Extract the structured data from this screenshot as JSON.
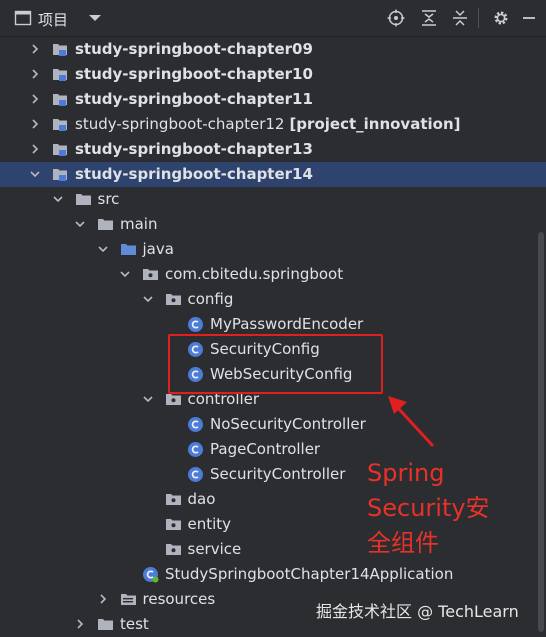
{
  "toolbar": {
    "title": "项目",
    "icons": [
      "project-view-icon",
      "dropdown-icon",
      "locate-icon",
      "expand-all-icon",
      "collapse-all-icon",
      "gear-icon",
      "minimize-icon"
    ]
  },
  "tree": [
    {
      "label": "study-springboot-chapter09",
      "bold": true,
      "expanded": false,
      "icon": "module-icon",
      "suffix": ""
    },
    {
      "label": "study-springboot-chapter10",
      "bold": true,
      "expanded": false,
      "icon": "module-icon",
      "suffix": ""
    },
    {
      "label": "study-springboot-chapter11",
      "bold": true,
      "expanded": false,
      "icon": "module-icon",
      "suffix": ""
    },
    {
      "label": "study-springboot-chapter12",
      "bold": false,
      "expanded": false,
      "icon": "module-icon",
      "suffix": "[project_innovation]"
    },
    {
      "label": "study-springboot-chapter13",
      "bold": true,
      "expanded": false,
      "icon": "module-icon",
      "suffix": ""
    },
    {
      "label": "study-springboot-chapter14",
      "bold": true,
      "expanded": true,
      "icon": "module-icon",
      "selected": true,
      "suffix": ""
    },
    {
      "label": "src",
      "icon": "folder-icon",
      "expanded": true
    },
    {
      "label": "main",
      "icon": "folder-icon",
      "expanded": true
    },
    {
      "label": "java",
      "icon": "source-folder-icon",
      "expanded": true
    },
    {
      "label": "com.cbitedu.springboot",
      "icon": "package-icon",
      "expanded": true
    },
    {
      "label": "config",
      "icon": "package-icon",
      "expanded": true
    },
    {
      "label": "MyPasswordEncoder",
      "icon": "class-icon"
    },
    {
      "label": "SecurityConfig",
      "icon": "class-icon"
    },
    {
      "label": "WebSecurityConfig",
      "icon": "class-icon"
    },
    {
      "label": "controller",
      "icon": "package-icon",
      "expanded": true
    },
    {
      "label": "NoSecurityController",
      "icon": "class-icon"
    },
    {
      "label": "PageController",
      "icon": "class-icon"
    },
    {
      "label": "SecurityController",
      "icon": "class-icon"
    },
    {
      "label": "dao",
      "icon": "package-icon"
    },
    {
      "label": "entity",
      "icon": "package-icon"
    },
    {
      "label": "service",
      "icon": "package-icon"
    },
    {
      "label": "StudySpringbootChapter14Application",
      "icon": "spring-boot-class-icon"
    },
    {
      "label": "resources",
      "icon": "resources-folder-icon",
      "expanded": false
    },
    {
      "label": "test",
      "icon": "folder-icon",
      "expanded": false
    }
  ],
  "annotation": {
    "lines": [
      "Spring",
      "Security安",
      "全组件"
    ],
    "color": "#e8312a"
  },
  "watermark": "掘金技术社区 @ TechLearn",
  "colors": {
    "background": "#2b2d30",
    "selection": "#2e436e",
    "folder": "#6e8fd0",
    "class_icon": "#4d7cd6",
    "annotation_red": "#e02020"
  }
}
